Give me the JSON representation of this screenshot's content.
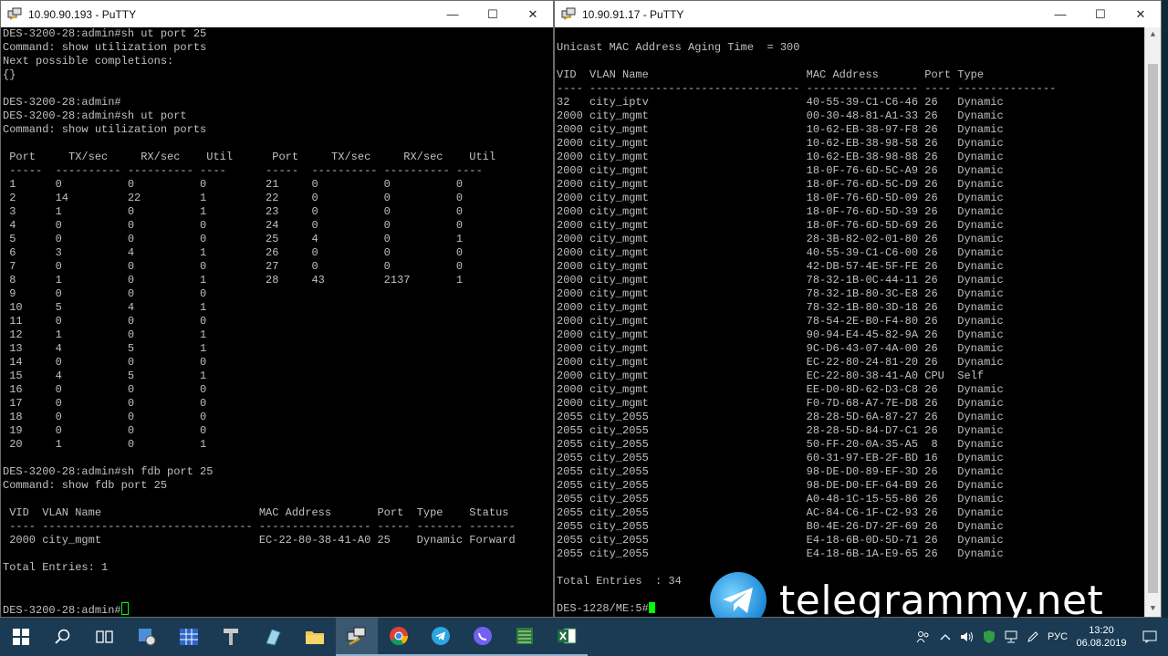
{
  "windows": [
    {
      "title": "10.90.90.193 - PuTTY",
      "lines": [
        "DES-3200-28:admin#sh ut port 25",
        "Command: show utilization ports",
        "Next possible completions:",
        "{}",
        "",
        "DES-3200-28:admin#",
        "DES-3200-28:admin#sh ut port",
        "Command: show utilization ports",
        "",
        " Port     TX/sec     RX/sec    Util      Port     TX/sec     RX/sec    Util",
        " -----  ---------- ---------- ----      -----  ---------- ---------- ----",
        " 1      0          0          0         21     0          0          0",
        " 2      14         22         1         22     0          0          0",
        " 3      1          0          1         23     0          0          0",
        " 4      0          0          0         24     0          0          0",
        " 5      0          0          0         25     4          0          1",
        " 6      3          4          1         26     0          0          0",
        " 7      0          0          0         27     0          0          0",
        " 8      1          0          1         28     43         2137       1",
        " 9      0          0          0",
        " 10     5          4          1",
        " 11     0          0          0",
        " 12     1          0          1",
        " 13     4          5          1",
        " 14     0          0          0",
        " 15     4          5          1",
        " 16     0          0          0",
        " 17     0          0          0",
        " 18     0          0          0",
        " 19     0          0          0",
        " 20     1          0          1",
        "",
        "DES-3200-28:admin#sh fdb port 25",
        "Command: show fdb port 25",
        "",
        " VID  VLAN Name                        MAC Address       Port  Type    Status",
        " ---- -------------------------------- ----------------- ----- ------- -------",
        " 2000 city_mgmt                        EC-22-80-38-41-A0 25    Dynamic Forward",
        "",
        "Total Entries: 1",
        "",
        "",
        "DES-3200-28:admin#"
      ]
    },
    {
      "title": "10.90.91.17 - PuTTY",
      "lines": [
        "",
        "Unicast MAC Address Aging Time  = 300",
        "",
        "VID  VLAN Name                        MAC Address       Port Type",
        "---- -------------------------------- ----------------- ---- ---------------",
        "32   city_iptv                        40-55-39-C1-C6-46 26   Dynamic",
        "2000 city_mgmt                        00-30-48-81-A1-33 26   Dynamic",
        "2000 city_mgmt                        10-62-EB-38-97-F8 26   Dynamic",
        "2000 city_mgmt                        10-62-EB-38-98-58 26   Dynamic",
        "2000 city_mgmt                        10-62-EB-38-98-88 26   Dynamic",
        "2000 city_mgmt                        18-0F-76-6D-5C-A9 26   Dynamic",
        "2000 city_mgmt                        18-0F-76-6D-5C-D9 26   Dynamic",
        "2000 city_mgmt                        18-0F-76-6D-5D-09 26   Dynamic",
        "2000 city_mgmt                        18-0F-76-6D-5D-39 26   Dynamic",
        "2000 city_mgmt                        18-0F-76-6D-5D-69 26   Dynamic",
        "2000 city_mgmt                        28-3B-82-02-01-80 26   Dynamic",
        "2000 city_mgmt                        40-55-39-C1-C6-00 26   Dynamic",
        "2000 city_mgmt                        42-DB-57-4E-5F-FE 26   Dynamic",
        "2000 city_mgmt                        78-32-1B-0C-44-11 26   Dynamic",
        "2000 city_mgmt                        78-32-1B-80-3C-E8 26   Dynamic",
        "2000 city_mgmt                        78-32-1B-80-3D-18 26   Dynamic",
        "2000 city_mgmt                        78-54-2E-B0-F4-80 26   Dynamic",
        "2000 city_mgmt                        90-94-E4-45-82-9A 26   Dynamic",
        "2000 city_mgmt                        9C-D6-43-07-4A-00 26   Dynamic",
        "2000 city_mgmt                        EC-22-80-24-81-20 26   Dynamic",
        "2000 city_mgmt                        EC-22-80-38-41-A0 CPU  Self",
        "2000 city_mgmt                        EE-D0-8D-62-D3-C8 26   Dynamic",
        "2000 city_mgmt                        F0-7D-68-A7-7E-D8 26   Dynamic",
        "2055 city_2055                        28-28-5D-6A-87-27 26   Dynamic",
        "2055 city_2055                        28-28-5D-84-D7-C1 26   Dynamic",
        "2055 city_2055                        50-FF-20-0A-35-A5  8   Dynamic",
        "2055 city_2055                        60-31-97-EB-2F-BD 16   Dynamic",
        "2055 city_2055                        98-DE-D0-89-EF-3D 26   Dynamic",
        "2055 city_2055                        98-DE-D0-EF-64-B9 26   Dynamic",
        "2055 city_2055                        A0-48-1C-15-55-86 26   Dynamic",
        "2055 city_2055                        AC-84-C6-1F-C2-93 26   Dynamic",
        "2055 city_2055                        B0-4E-26-D7-2F-69 26   Dynamic",
        "2055 city_2055                        E4-18-6B-0D-5D-71 26   Dynamic",
        "2055 city_2055                        E4-18-6B-1A-E9-65 26   Dynamic",
        "",
        "Total Entries  : 34",
        "",
        "DES-1228/ME:5#"
      ]
    }
  ],
  "taskbar": {
    "apps": [
      "windows-start",
      "search",
      "task-view",
      "network-tool",
      "table-app",
      "putty-config",
      "notepad",
      "file-explorer",
      "putty",
      "chrome",
      "telegram",
      "viber",
      "spreadsheet",
      "excel"
    ],
    "language": "РУС",
    "time": "13:20",
    "date": "06.08.2019"
  },
  "watermark": {
    "text": "telegrammy.net"
  },
  "colors": {
    "terminal_bg": "#000000",
    "terminal_fg": "#c0c0c0",
    "cursor": "#00ff00",
    "taskbar": "#1a3b53"
  }
}
